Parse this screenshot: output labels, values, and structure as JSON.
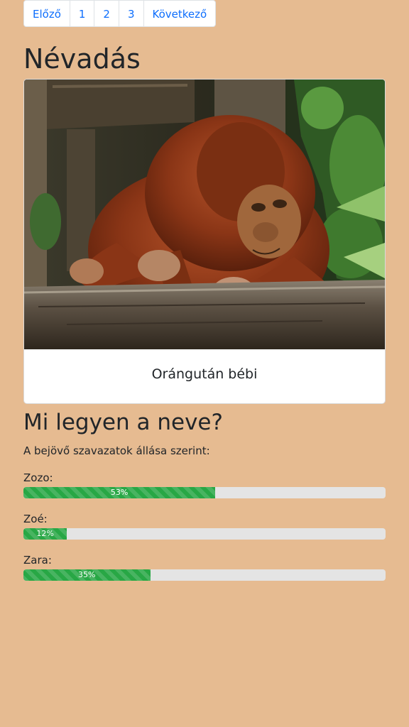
{
  "pagination": {
    "prev": "Előző",
    "pages": [
      "1",
      "2",
      "3"
    ],
    "next": "Következő"
  },
  "page_title": "Névadás",
  "card": {
    "caption": "Orángután bébi",
    "image_subject": "baby orangutan leaning on a log"
  },
  "poll": {
    "question": "Mi legyen a neve?",
    "subtitle": "A bejövő szavazatok állása szerint:",
    "options": [
      {
        "label": "Zozo:",
        "percent": 53,
        "percent_text": "53%"
      },
      {
        "label": "Zoé:",
        "percent": 12,
        "percent_text": "12%"
      },
      {
        "label": "Zara:",
        "percent": 35,
        "percent_text": "35%"
      }
    ]
  },
  "colors": {
    "background": "#e6bb91",
    "link": "#0d6efd",
    "progress_fill": "#28a745",
    "progress_track": "#e4e4e4"
  }
}
